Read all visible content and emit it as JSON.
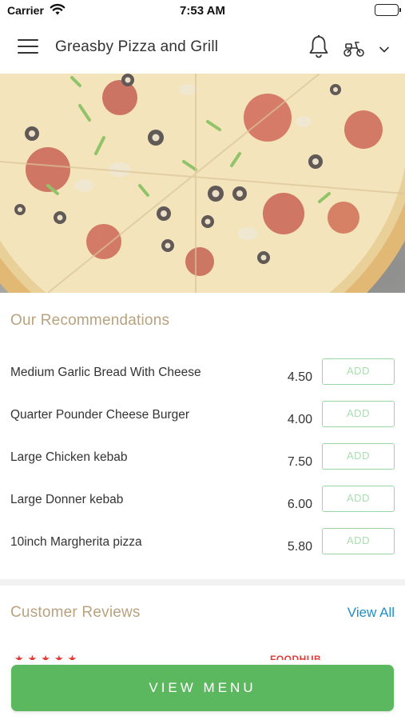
{
  "status_bar": {
    "carrier": "Carrier",
    "time": "7:53 AM"
  },
  "header": {
    "title": "Greasby Pizza and Grill",
    "icons": [
      "hamburger-menu-icon",
      "bell-icon",
      "scooter-icon",
      "chevron-down-icon"
    ]
  },
  "hero": {
    "image": "pizza-photo"
  },
  "recommendations": {
    "title": "Our Recommendations",
    "items": [
      {
        "name": "Medium Garlic Bread With Cheese",
        "price": "4.50",
        "add_label": "ADD"
      },
      {
        "name": "Quarter Pounder Cheese Burger",
        "price": "4.00",
        "add_label": "ADD"
      },
      {
        "name": "Large Chicken kebab",
        "price": "7.50",
        "add_label": "ADD"
      },
      {
        "name": "Large Donner kebab",
        "price": "6.00",
        "add_label": "ADD"
      },
      {
        "name": "10inch Margherita pizza",
        "price": "5.80",
        "add_label": "ADD"
      }
    ]
  },
  "reviews": {
    "title": "Customer Reviews",
    "view_all_label": "View All",
    "preview": {
      "stars": "★★★★★",
      "name": "...",
      "source": "FOODHUB",
      "date": "..."
    }
  },
  "footer": {
    "view_menu_label": "VIEW MENU"
  },
  "colors": {
    "accent_green": "#5cb85f",
    "section_title": "#b9a27e",
    "link_blue": "#1d8fc7",
    "star_red": "#e23b35"
  }
}
